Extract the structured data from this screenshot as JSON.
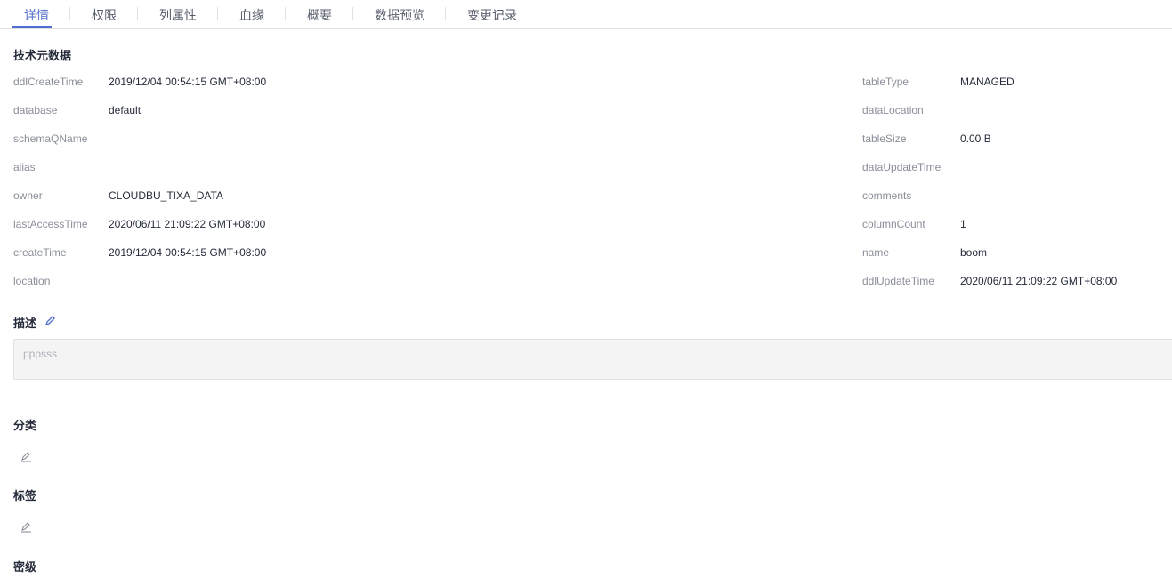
{
  "tabs": [
    "详情",
    "权限",
    "列属性",
    "血缘",
    "概要",
    "数据预览",
    "变更记录"
  ],
  "sections": {
    "tech": "技术元数据",
    "desc": "描述",
    "category": "分类",
    "tags": "标签",
    "secret": "密级"
  },
  "left": [
    {
      "label": "ddlCreateTime",
      "value": "2019/12/04 00:54:15 GMT+08:00"
    },
    {
      "label": "database",
      "value": "default"
    },
    {
      "label": "schemaQName",
      "value": ""
    },
    {
      "label": "alias",
      "value": ""
    },
    {
      "label": "owner",
      "value": "CLOUDBU_TIXA_DATA"
    },
    {
      "label": "lastAccessTime",
      "value": "2020/06/11 21:09:22 GMT+08:00"
    },
    {
      "label": "createTime",
      "value": "2019/12/04 00:54:15 GMT+08:00"
    },
    {
      "label": "location",
      "value": ""
    }
  ],
  "right": [
    {
      "label": "tableType",
      "value": "MANAGED"
    },
    {
      "label": "dataLocation",
      "value": ""
    },
    {
      "label": "tableSize",
      "value": "0.00 B"
    },
    {
      "label": "dataUpdateTime",
      "value": ""
    },
    {
      "label": "comments",
      "value": ""
    },
    {
      "label": "columnCount",
      "value": "1"
    },
    {
      "label": "name",
      "value": "boom"
    },
    {
      "label": "ddlUpdateTime",
      "value": "2020/06/11 21:09:22 GMT+08:00"
    }
  ],
  "description": "pppsss",
  "colors": {
    "accent": "#526ecc"
  }
}
